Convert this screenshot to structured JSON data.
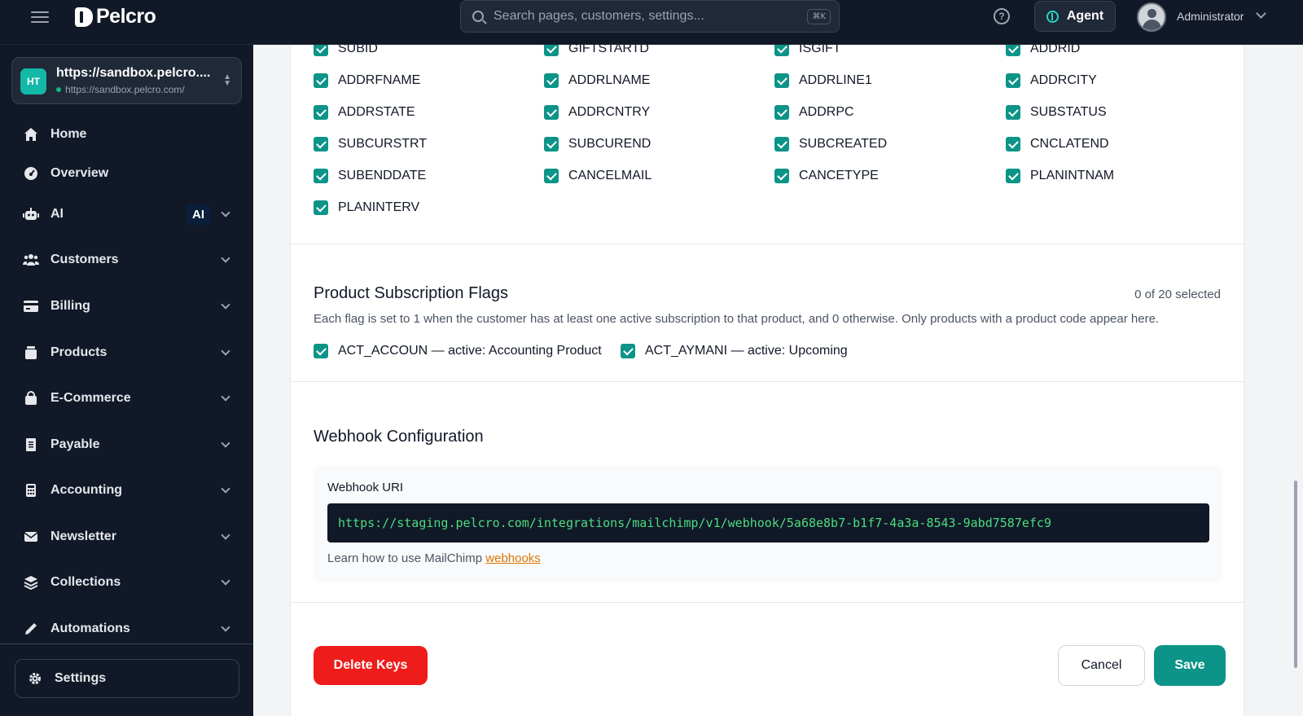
{
  "header": {
    "brand": "Pelcro",
    "search_placeholder": "Search pages, customers, settings...",
    "search_shortcut": "⌘K",
    "agent_label": "Agent",
    "user_name": "Administrator"
  },
  "sidebar": {
    "org": {
      "initials": "HT",
      "name": "https://sandbox.pelcro....",
      "url": "https://sandbox.pelcro.com/"
    },
    "items": [
      {
        "label": "Home",
        "icon": "home-icon"
      },
      {
        "label": "Overview",
        "icon": "overview-icon"
      },
      {
        "label": "AI",
        "icon": "robot-icon",
        "badge": "AI"
      },
      {
        "label": "Customers",
        "icon": "users-icon"
      },
      {
        "label": "Billing",
        "icon": "credit-card-icon"
      },
      {
        "label": "Products",
        "icon": "box-icon"
      },
      {
        "label": "E-Commerce",
        "icon": "shopping-bag-icon"
      },
      {
        "label": "Payable",
        "icon": "receipt-icon"
      },
      {
        "label": "Accounting",
        "icon": "calculator-icon"
      },
      {
        "label": "Newsletter",
        "icon": "envelope-icon"
      },
      {
        "label": "Collections",
        "icon": "layers-icon"
      },
      {
        "label": "Automations",
        "icon": "pen-icon"
      }
    ],
    "settings_label": "Settings"
  },
  "fields": {
    "rows": [
      [
        "SUBID",
        "GIFTSTARTD",
        "ISGIFT",
        "ADDRID"
      ],
      [
        "ADDRFNAME",
        "ADDRLNAME",
        "ADDRLINE1",
        "ADDRCITY"
      ],
      [
        "ADDRSTATE",
        "ADDRCNTRY",
        "ADDRPC",
        "SUBSTATUS"
      ],
      [
        "SUBCURSTRT",
        "SUBCUREND",
        "SUBCREATED",
        "CNCLATEND"
      ],
      [
        "SUBENDDATE",
        "CANCELMAIL",
        "CANCETYPE",
        "PLANINTNAM"
      ],
      [
        "PLANINTERV"
      ]
    ]
  },
  "flags": {
    "title": "Product Subscription Flags",
    "count": "0 of 20 selected",
    "description": "Each flag is set to 1 when the customer has at least one active subscription to that product, and 0 otherwise. Only products with a product code appear here.",
    "items": [
      "ACT_ACCOUN — active: Accounting Product",
      "ACT_AYMANI — active: Upcoming"
    ]
  },
  "webhook": {
    "title": "Webhook Configuration",
    "label": "Webhook URI",
    "uri": "https://staging.pelcro.com/integrations/mailchimp/v1/webhook/5a68e8b7-b1f7-4a3a-8543-9abd7587efc9",
    "help_text": "Learn how to use MailChimp ",
    "help_link": "webhooks"
  },
  "actions": {
    "delete": "Delete Keys",
    "cancel": "Cancel",
    "save": "Save"
  },
  "colors": {
    "accent": "#0d9488",
    "danger": "#ef1c1c",
    "sidebar_bg": "#111827"
  }
}
